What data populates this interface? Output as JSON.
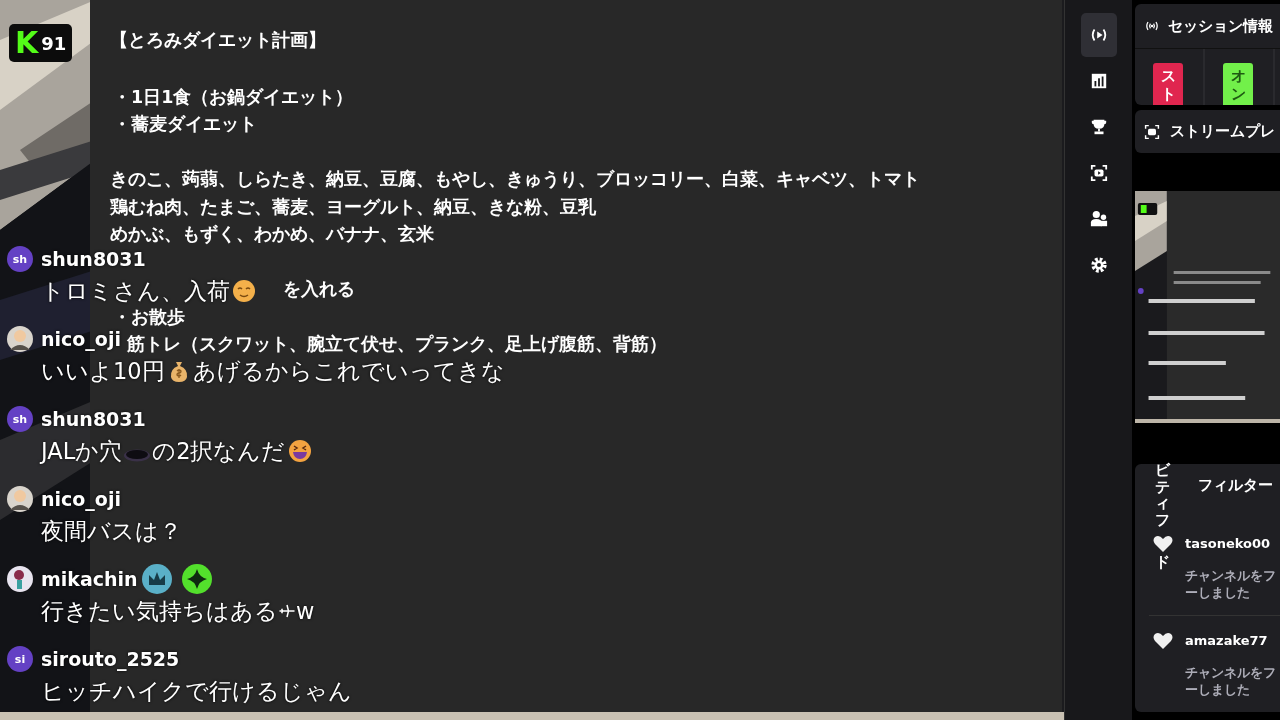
{
  "overlay_badge": {
    "letter": "K",
    "count": "91"
  },
  "plan": {
    "title": "【とろみダイエット計画】",
    "sections": [
      [
        {
          "kind": "item",
          "text": "・1日1食（お鍋ダイエット）"
        },
        {
          "kind": "item",
          "text": "・蕎麦ダイエット"
        }
      ],
      [
        {
          "kind": "plain",
          "text": "きのこ、蒟蒻、しらたき、納豆、豆腐、もやし、きゅうり、ブロッコリー、白菜、キャベツ、トマト"
        },
        {
          "kind": "plain",
          "text": "鶏むね肉、たまご、蕎麦、ヨーグルト、納豆、きな粉、豆乳"
        },
        {
          "kind": "plain",
          "text": "めかぶ、もずく、わかめ、バナナ、玄米"
        }
      ],
      [
        {
          "kind": "tail",
          "text": "を入れる"
        },
        {
          "kind": "item",
          "text": "・お散歩"
        },
        {
          "kind": "hanging",
          "text": "筋トレ（スクワット、腕立て伏せ、プランク、足上げ腹筋、背筋）"
        }
      ]
    ]
  },
  "chat": [
    {
      "user": "shun8031",
      "avatar": {
        "kind": "initials",
        "text": "sh"
      },
      "message": [
        {
          "kind": "text",
          "text": "トロミさん、入荷"
        },
        {
          "kind": "relieved"
        }
      ]
    },
    {
      "user": "nico_oji",
      "avatar": {
        "kind": "figure"
      },
      "message": [
        {
          "kind": "text",
          "text": "いいよ10円"
        },
        {
          "kind": "moneybag"
        },
        {
          "kind": "text",
          "text": "あげるからこれでいってきな"
        }
      ]
    },
    {
      "user": "shun8031",
      "avatar": {
        "kind": "initials",
        "text": "sh"
      },
      "message": [
        {
          "kind": "text",
          "text": "JALか穴"
        },
        {
          "kind": "hole"
        },
        {
          "kind": "text",
          "text": "の2択なんだ"
        },
        {
          "kind": "laugh"
        }
      ]
    },
    {
      "user": "nico_oji",
      "avatar": {
        "kind": "figure"
      },
      "message": [
        {
          "kind": "text",
          "text": "夜間バスは？"
        }
      ]
    },
    {
      "user": "mikachin",
      "avatar": {
        "kind": "art"
      },
      "badges": [
        {
          "kind": "crown"
        },
        {
          "kind": "sparkle"
        }
      ],
      "message": [
        {
          "kind": "text",
          "text": "行きたい気持ちはある"
        },
        {
          "kind": "plane"
        },
        {
          "kind": "text",
          "text": "w"
        }
      ]
    },
    {
      "user": "sirouto_2525",
      "avatar": {
        "kind": "initials",
        "text": "si"
      },
      "message": [
        {
          "kind": "text",
          "text": "ヒッチハイクで行けるじゃん"
        }
      ]
    }
  ],
  "sidebar": {
    "items": [
      {
        "kind": "broadcast",
        "selected": true
      },
      {
        "kind": "chart",
        "selected": false
      },
      {
        "kind": "trophy",
        "selected": false
      },
      {
        "kind": "capture",
        "selected": false
      },
      {
        "kind": "users",
        "selected": false
      },
      {
        "kind": "gear",
        "selected": false
      }
    ]
  },
  "session_card": {
    "title": "セッション情報",
    "tiles": [
      {
        "text": "スト",
        "color": "#e0264f"
      },
      {
        "text": "オン",
        "color": "#72f04a"
      }
    ]
  },
  "preview_card": {
    "title": "ストリームプレ"
  },
  "feed": {
    "title_parts": [
      "ビティフ",
      "ド"
    ],
    "filter": "フィルター",
    "events": [
      {
        "user": "tasoneko00",
        "lines": [
          "チャンネルをフ",
          "ーしました"
        ]
      },
      {
        "user": "amazake77",
        "lines": [
          "チャンネルをフ",
          "ーしました"
        ]
      }
    ]
  }
}
